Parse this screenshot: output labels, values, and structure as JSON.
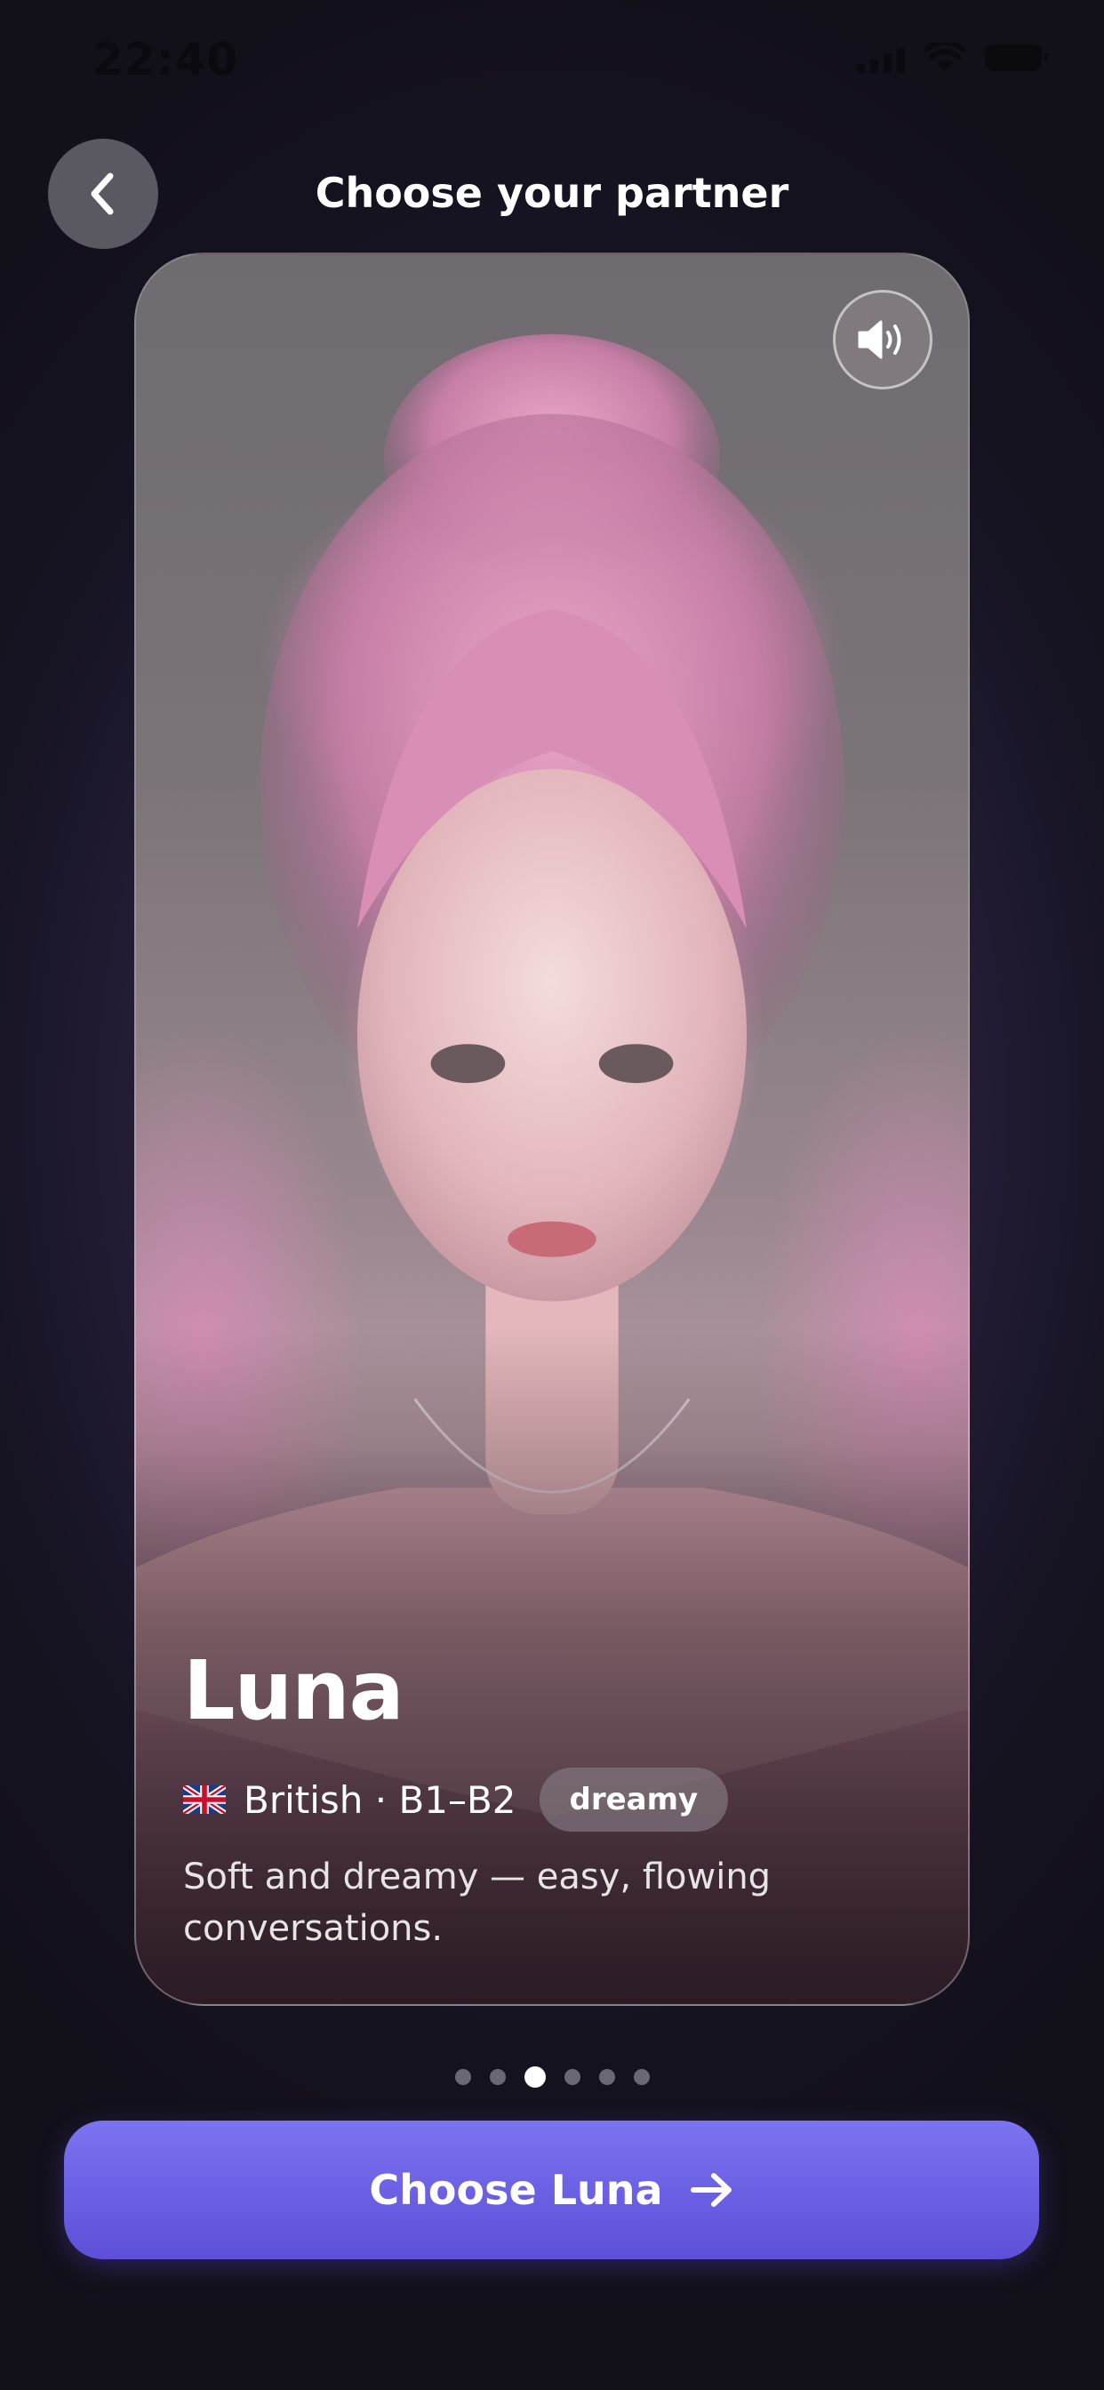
{
  "status_bar": {
    "time": "22:40"
  },
  "header": {
    "title": "Choose your partner",
    "back_icon": "chevron-left-icon"
  },
  "card": {
    "sound_icon": "speaker-volume-icon",
    "name": "Luna",
    "flag_icon": "uk-flag-icon",
    "meta": "British · B1–B2",
    "tag": "dreamy",
    "description": "Soft and dreamy — easy, flowing conversations."
  },
  "pager": {
    "count": 6,
    "active_index": 2
  },
  "cta": {
    "label": "Choose Luna",
    "icon": "arrow-right-icon"
  },
  "colors": {
    "background": "#1a1626",
    "accent": "#6a5ee6",
    "back_button": "#5a5860"
  }
}
